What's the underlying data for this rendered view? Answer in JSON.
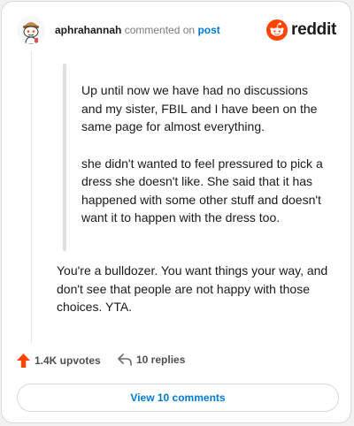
{
  "header": {
    "username": "aphrahannah",
    "action_text": "commented on",
    "post_link": "post",
    "brand": "reddit"
  },
  "quote": {
    "paragraphs": [
      "Up until now we have had no discussions and my sister, FBIL and I have been on the same page for almost everything.",
      "she didn't wanted to feel pressured to pick a dress she doesn't like. She said that it has happened with some other stuff and doesn't want it to happen with the dress too."
    ]
  },
  "comment": {
    "text": "You're a bulldozer. You want things your way, and don't see that people are not happy with those choices. YTA."
  },
  "actions": {
    "upvotes": "1.4K upvotes",
    "replies": "10 replies"
  },
  "footer": {
    "view_button": "View 10 comments"
  },
  "colors": {
    "accent_blue": "#0079d3",
    "reddit_orange": "#ff4500",
    "upvote_orange": "#ff4500"
  },
  "icons": {
    "avatar": "snoo-avatar-icon",
    "brand": "reddit-logo-icon",
    "upvote": "upvote-arrow-icon",
    "reply": "reply-arrow-icon"
  }
}
